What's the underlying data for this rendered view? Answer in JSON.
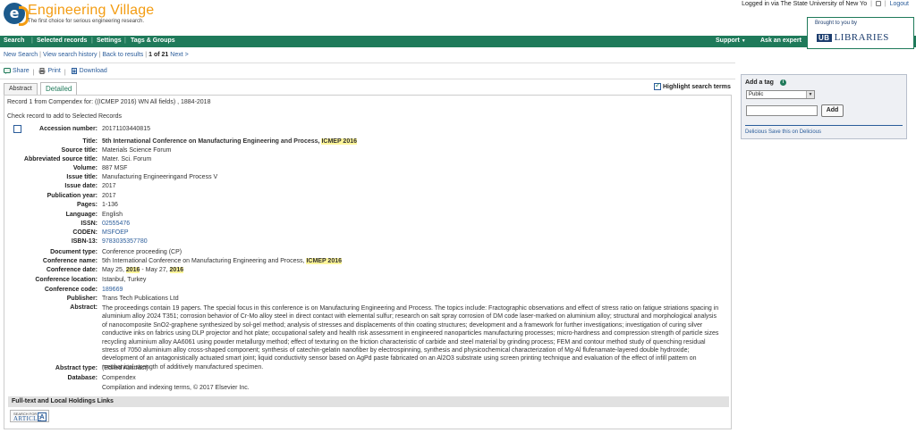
{
  "header": {
    "logo_letter": "e",
    "title": "Engineering Village",
    "tagline": "The first choice for serious engineering research.",
    "logged_in_text": "Logged in via The State University of New Yo",
    "help_icon": "help-icon",
    "logout_label": "Logout",
    "brought_by": "Brought to you by",
    "library_mark": "UB",
    "library_name": "LIBRARIES"
  },
  "nav": {
    "search": "Search",
    "selected_records": "Selected records",
    "settings": "Settings",
    "tags_groups": "Tags & Groups",
    "support": "Support",
    "ask_expert": "Ask an expert"
  },
  "breadcrumb": {
    "new_search": "New Search",
    "view_history": "View search history",
    "back_results": "Back to results",
    "position": "1 of 21",
    "next": "Next >"
  },
  "actions": {
    "share": "Share",
    "print": "Print",
    "download": "Download"
  },
  "tabs": {
    "abstract": "Abstract",
    "detailed": "Detailed"
  },
  "highlight_label": "Highlight search terms",
  "record_line": "Record 1 from Compendex for: ((ICMEP 2016) WN All fields) , 1884-2018",
  "check_line": "Check record to add to Selected Records",
  "fields": {
    "accession": {
      "label": "Accession number:",
      "value": "20171103440815"
    },
    "title": {
      "label": "Title:",
      "value": "5th International Conference on Manufacturing Engineering and Process,",
      "hl": "ICMEP 2016"
    },
    "source_title": {
      "label": "Source title:",
      "value": "Materials Science Forum"
    },
    "abbrev_source": {
      "label": "Abbreviated source title:",
      "value": "Mater. Sci. Forum"
    },
    "volume": {
      "label": "Volume:",
      "value": "887 MSF"
    },
    "issue_title": {
      "label": "Issue title:",
      "value": "Manufacturing Engineeringand Process V"
    },
    "issue_date": {
      "label": "Issue date:",
      "value": "2017"
    },
    "pub_year": {
      "label": "Publication year:",
      "value": "2017"
    },
    "pages": {
      "label": "Pages:",
      "value": "1-136"
    },
    "language": {
      "label": "Language:",
      "value": "English"
    },
    "issn": {
      "label": "ISSN:",
      "value": "02555476"
    },
    "coden": {
      "label": "CODEN:",
      "value": "MSFOEP"
    },
    "isbn": {
      "label": "ISBN-13:",
      "value": "9783035357780"
    },
    "doc_type": {
      "label": "Document type:",
      "value": "Conference proceeding (CP)"
    },
    "conf_name": {
      "label": "Conference name:",
      "value": "5th International Conference on Manufacturing Engineering and Process,",
      "hl": "ICMEP 2016"
    },
    "conf_date": {
      "label": "Conference date:",
      "value_a": "May 25,",
      "hl_a": "2016",
      "value_b": "- May 27,",
      "hl_b": "2016"
    },
    "conf_location": {
      "label": "Conference location:",
      "value": "Istanbul, Turkey"
    },
    "conf_code": {
      "label": "Conference code:",
      "value": "189669"
    },
    "publisher": {
      "label": "Publisher:",
      "value": "Trans Tech Publications Ltd"
    },
    "abstract": {
      "label": "Abstract:",
      "value": "The proceedings contain 19 papers. The special focus in this conference is on Manufacturing Engineering and Process. The topics include: Fractographic observations and effect of stress ratio on fatigue striations spacing in aluminium alloy 2024 T351; corrosion behavior of Cr-Mo alloy steel in direct contact with elemental sulfur; research on salt spray corrosion of DM code laser-marked on aluminium alloy; structural and morphological analysis of nanocomposite SnO2-graphene synthesized by sol-gel method; analysis of stresses and displacements of thin coating structures; development and a framework for further investigations; investigation of curing silver conductive inks on fabrics using DLP projector and hot plate; occupational safety and health risk assessment in engineered nanoparticles manufacturing processes; micro-hardness and compression strength of particle sizes recycling aluminium alloy AA6061 using powder metallurgy method; effect of texturing on the friction characteristic of carbide and steel material by grinding process; FEM and contour method study of quenching residual stress of 7050 aluminium alloy cross-shaped component; synthesis of catechin-gelatin nanofiber by electrospinning, synthesis and physicochemical characterization of Mg-Al flufenamate-layered double hydroxide; development of an antagonistically actuated smart joint; liquid conductivity sensor based on AgPd paste fabricated on an Al2O3 substrate using screen printing technique and evaluation of the effect of infill pattern on mechanical strength of additively manufactured specimen."
    },
    "abstract_type": {
      "label": "Abstract type:",
      "value": "(Edited Abstract)"
    },
    "database": {
      "label": "Database:",
      "value": "Compendex"
    },
    "copyright": {
      "value": "Compilation and indexing terms, © 2017 Elsevier Inc."
    }
  },
  "fulltext_title": "Full-text and Local Holdings Links",
  "article_button": {
    "top": "SEARCH FOR",
    "main": "ARTICLE",
    "badge": "A"
  },
  "tag_panel": {
    "title": "Add a tag",
    "select_value": "Public",
    "add_label": "Add",
    "delicious": "Delicious",
    "save_delicious": "Save this on Delicious"
  }
}
